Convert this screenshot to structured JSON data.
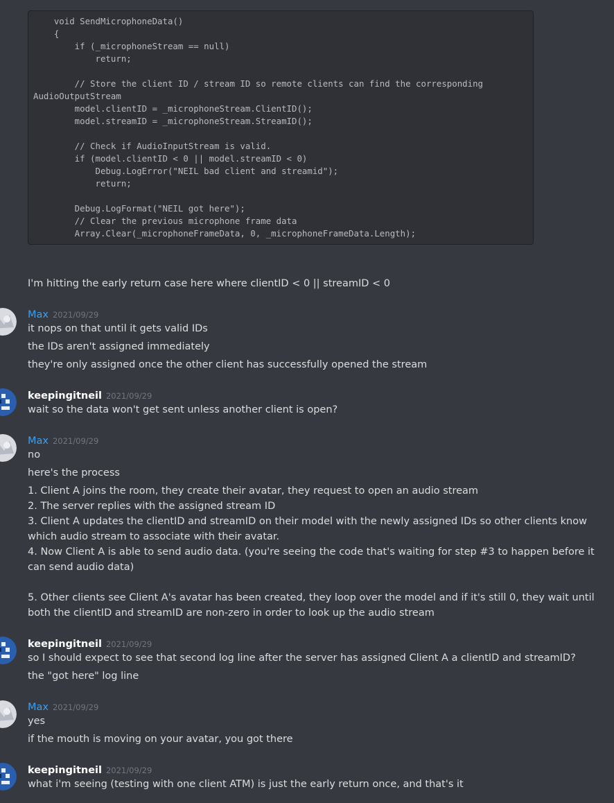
{
  "code": {
    "lines": [
      "    void SendMicrophoneData()",
      "    {",
      "        if (_microphoneStream == null)",
      "            return;",
      "",
      "        // Store the client ID / stream ID so remote clients can find the corresponding",
      "AudioOutputStream",
      "        model.clientID = _microphoneStream.ClientID();",
      "        model.streamID = _microphoneStream.StreamID();",
      "",
      "        // Check if AudioInputStream is valid.",
      "        if (model.clientID < 0 || model.streamID < 0)",
      "            Debug.LogError(\"NEIL bad client and streamid\");",
      "            return;",
      "",
      "        Debug.LogFormat(\"NEIL got here\");",
      "        // Clear the previous microphone frame data",
      "        Array.Clear(_microphoneFrameData, 0, _microphoneFrameData.Length);"
    ]
  },
  "messages": [
    {
      "text": "I'm hitting the early return case here where clientID < 0 || streamID < 0"
    },
    {
      "author": "Max",
      "timestamp": "2021/09/29",
      "lines": [
        "it nops on that until it gets valid IDs",
        "the IDs aren't assigned immediately",
        "they're only assigned once the other client has successfully opened the stream"
      ]
    },
    {
      "author": "keepingitneil",
      "timestamp": "2021/09/29",
      "lines": [
        "wait so the data won't get sent unless another client is open?"
      ]
    },
    {
      "author": "Max",
      "timestamp": "2021/09/29",
      "lines": [
        "no",
        "here's the process",
        "1. Client A joins the room, they create their avatar, they request to open an audio stream",
        "2. The server replies with the assigned stream ID",
        "3. Client A updates the clientID and streamID on their model with the newly assigned IDs so other clients know which audio stream to associate with their avatar.",
        "4. Now Client A is able to send audio data. (you're seeing the code that's waiting for step #3 to happen before it can send audio data)",
        "5. Other clients see Client A's avatar has been created, they loop over the model and if it's still 0, they wait until both the clientID and streamID are non-zero in order to look up the audio stream"
      ]
    },
    {
      "author": "keepingitneil",
      "timestamp": "2021/09/29",
      "lines": [
        "so I should expect to see that second log line after the server has assigned Client A a clientID and streamID?",
        "the \"got here\" log line"
      ]
    },
    {
      "author": "Max",
      "timestamp": "2021/09/29",
      "lines": [
        "yes",
        "if the mouth is moving on your avatar, you got there"
      ]
    },
    {
      "author": "keepingitneil",
      "timestamp": "2021/09/29",
      "lines": [
        "what i'm seeing (testing with one client ATM) is just the early return once, and that's it"
      ]
    }
  ],
  "colors": {
    "max_name": "#3ba0f0",
    "neil_name": "#ffffff",
    "background": "#36393f"
  }
}
